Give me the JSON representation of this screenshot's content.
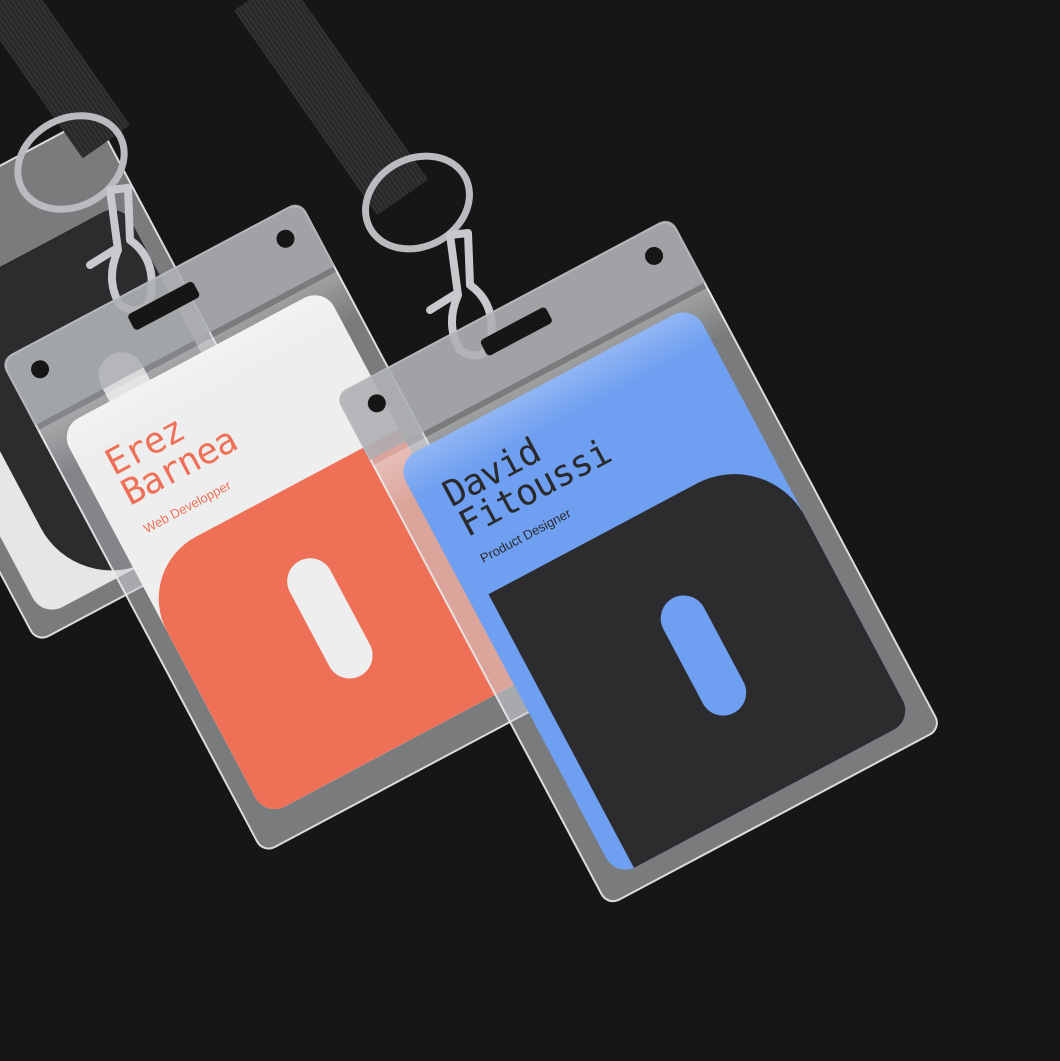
{
  "badges": [
    {
      "name": "Erez\nBarnea",
      "role": "Web Developper",
      "card_color": "#eeeeee",
      "text_color": "#ee7157",
      "shape_color": "#ee7157",
      "pill_color": "#eeeeee"
    },
    {
      "name": "David\nFitoussi",
      "role": "Product Designer",
      "card_color": "#6f9ff0",
      "text_color": "#2a2a2c",
      "shape_color": "#2c2c2e",
      "pill_color": "#6f9ff0"
    }
  ],
  "background_color": "#161616",
  "lanyard_color": "#2b2b2d",
  "metal_color": "#b9bbbf"
}
